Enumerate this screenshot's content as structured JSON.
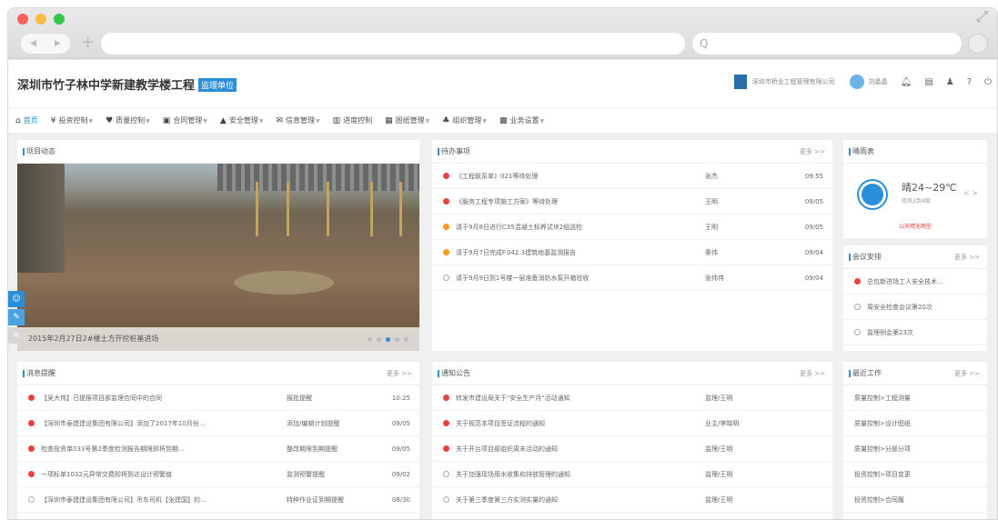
{
  "browser": {
    "search_placeholder": "Q"
  },
  "header": {
    "project_title": "深圳市竹子林中学新建教学楼工程",
    "role_badge": "监理单位",
    "company": "深圳市桥业工程管理有限公司",
    "user": "刘晶晶"
  },
  "nav": [
    {
      "label": "首页",
      "icon": "home-icon",
      "active": true
    },
    {
      "label": "投资控制",
      "icon": "money-icon"
    },
    {
      "label": "质量控制",
      "icon": "shield-icon"
    },
    {
      "label": "合同管理",
      "icon": "contract-icon"
    },
    {
      "label": "安全管理",
      "icon": "safety-icon"
    },
    {
      "label": "信息管理",
      "icon": "info-icon"
    },
    {
      "label": "进度控制",
      "icon": "chart-icon"
    },
    {
      "label": "图纸管理",
      "icon": "drawing-icon"
    },
    {
      "label": "组织管理",
      "icon": "org-icon"
    },
    {
      "label": "业务设置",
      "icon": "settings-icon"
    }
  ],
  "project_news": {
    "title": "项目动态",
    "caption": "2015年2月27日2#楼土方开挖桩基进场"
  },
  "todo": {
    "title": "待办事项",
    "more": "更多 >>",
    "rows": [
      {
        "status": "red",
        "text": "《工程联系单》021等待处理",
        "person": "张杰",
        "time": "09:55"
      },
      {
        "status": "red",
        "text": "《服务工程专项施工方案》等待处理",
        "person": "王明",
        "time": "09/05"
      },
      {
        "status": "orange",
        "text": "请于9月8日进行C35混凝土标养试块2组送检",
        "person": "王明",
        "time": "09/05"
      },
      {
        "status": "orange",
        "text": "请于9月7日完成F.042.3建筑地基监测报告",
        "person": "秦伟",
        "time": "09/04"
      },
      {
        "status": "gray",
        "text": "请于9月9日到1号楼一层准备消防水泵开箱验收",
        "person": "张伟伟",
        "time": "09/04"
      }
    ]
  },
  "weather": {
    "title": "晴雨表",
    "temp": "晴24~29℃",
    "wind": "南风3到4级",
    "air": "以天晴无雨型",
    "arrows": "< >"
  },
  "meetings": {
    "title": "会议安排",
    "more": "更多 >>",
    "rows": [
      {
        "status": "red",
        "text": "总包新进场工人安全技术..."
      },
      {
        "status": "gray",
        "text": "周安全检查会议第20次"
      },
      {
        "status": "gray",
        "text": "监理例会第23次"
      }
    ]
  },
  "messages": {
    "title": "消息提醒",
    "more": "更多 >>",
    "rows": [
      {
        "status": "red",
        "text": "【吴大伟】已提报项目部监理合同中的合同",
        "type": "报批提醒",
        "time": "10:25"
      },
      {
        "status": "red",
        "text": "【深圳市泰建建设集团有限公司】添加了2017年10月份...",
        "type": "添加/编辑计划提醒",
        "time": "09/05"
      },
      {
        "status": "red",
        "text": "检查投资单033号第2季度检测报告期限即将到期...",
        "type": "整改期限到期提醒",
        "time": "09/05"
      },
      {
        "status": "red",
        "text": "一项标单1032元异常交费即将到达设计预警值",
        "type": "监测预警提醒",
        "time": "09/02"
      },
      {
        "status": "gray",
        "text": "【深圳市泰建建设集团有限公司】吊车司机【张建国】的...",
        "type": "特种作业证到期提醒",
        "time": "08/30"
      }
    ]
  },
  "notices": {
    "title": "通知公告",
    "more": "更多 >>",
    "rows": [
      {
        "status": "red",
        "text": "转发市建设局关于\"安全生产月\"活动通知",
        "from": "监理/王明"
      },
      {
        "status": "red",
        "text": "关于规范本项目签证流程的通知",
        "from": "业主/李晓明"
      },
      {
        "status": "red",
        "text": "关于开台项目部组织周末活动的通知",
        "from": "监理/王明"
      },
      {
        "status": "gray",
        "text": "关于加强现场用水收集和排放管理的通知",
        "from": "监理/王明"
      },
      {
        "status": "gray",
        "text": "关于第三季度第三方实测实量的通知",
        "from": "监理/王明"
      }
    ]
  },
  "recent_work": {
    "title": "最近工作",
    "more": "更多 >>",
    "rows": [
      {
        "text": "质量控制>工程测量"
      },
      {
        "text": "质量控制>设计图纸"
      },
      {
        "text": "质量控制>分部分项"
      },
      {
        "text": "投资控制>项目变更"
      },
      {
        "text": "投资控制>合同履"
      }
    ]
  }
}
